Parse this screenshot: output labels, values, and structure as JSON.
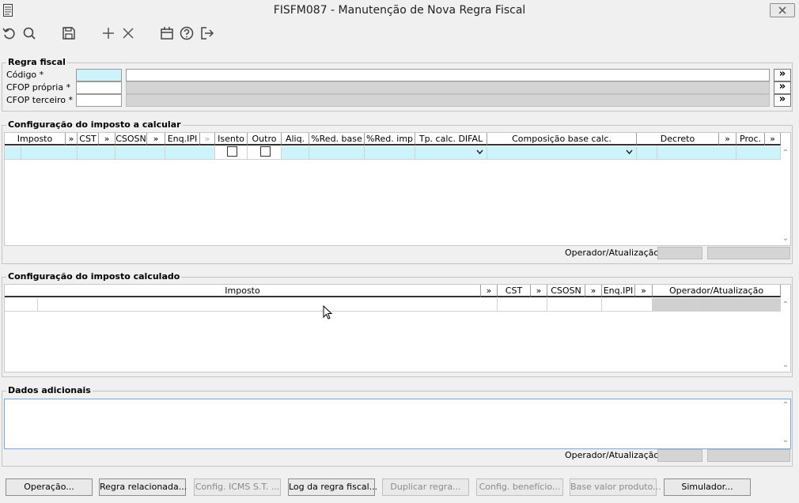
{
  "window": {
    "title": "FISFM087 - Manutenção de Nova Regra Fiscal"
  },
  "toolbar": {
    "icons": [
      "undo-icon",
      "search-icon",
      "save-icon",
      "add-icon",
      "delete-icon",
      "calendar-icon",
      "help-icon",
      "exit-icon"
    ]
  },
  "regra_fiscal": {
    "title": "Regra fiscal",
    "codigo_label": "Código *",
    "cfop_propria_label": "CFOP própria *",
    "cfop_terceiro_label": "CFOP terceiro *",
    "more_symbol": "»"
  },
  "config_calcular": {
    "title": "Configuração do imposto a calcular",
    "columns": {
      "imposto": "Imposto",
      "more": "»",
      "cst": "CST",
      "csosn": "CSOSN",
      "enq_ipi": "Enq.IPI",
      "isento": "Isento",
      "outro": "Outro",
      "aliq": "Aliq.",
      "red_base": "%Red. base",
      "red_imp": "%Red. imp",
      "tp_calc_difal": "Tp. calc. DIFAL",
      "composicao": "Composição base calc.",
      "decreto": "Decreto",
      "proc": "Proc."
    },
    "operador_label": "Operador/Atualização"
  },
  "config_calculado": {
    "title": "Configuração do imposto calculado",
    "columns": {
      "imposto": "Imposto",
      "more": "»",
      "cst": "CST",
      "csosn": "CSOSN",
      "enq_ipi": "Enq.IPI",
      "operador": "Operador/Atualização"
    }
  },
  "dados_adicionais": {
    "title": "Dados adicionais",
    "operador_label": "Operador/Atualização"
  },
  "buttons": {
    "operacao": "Operação...",
    "regra_relacionada": "Regra relacionada...",
    "config_icms": "Config. ICMS S.T. ...",
    "log_regra": "Log da regra fiscal...",
    "duplicar": "Duplicar regra...",
    "config_beneficio": "Config. benefício...",
    "base_valor": "Base valor produto...",
    "simulador": "Simulador..."
  }
}
